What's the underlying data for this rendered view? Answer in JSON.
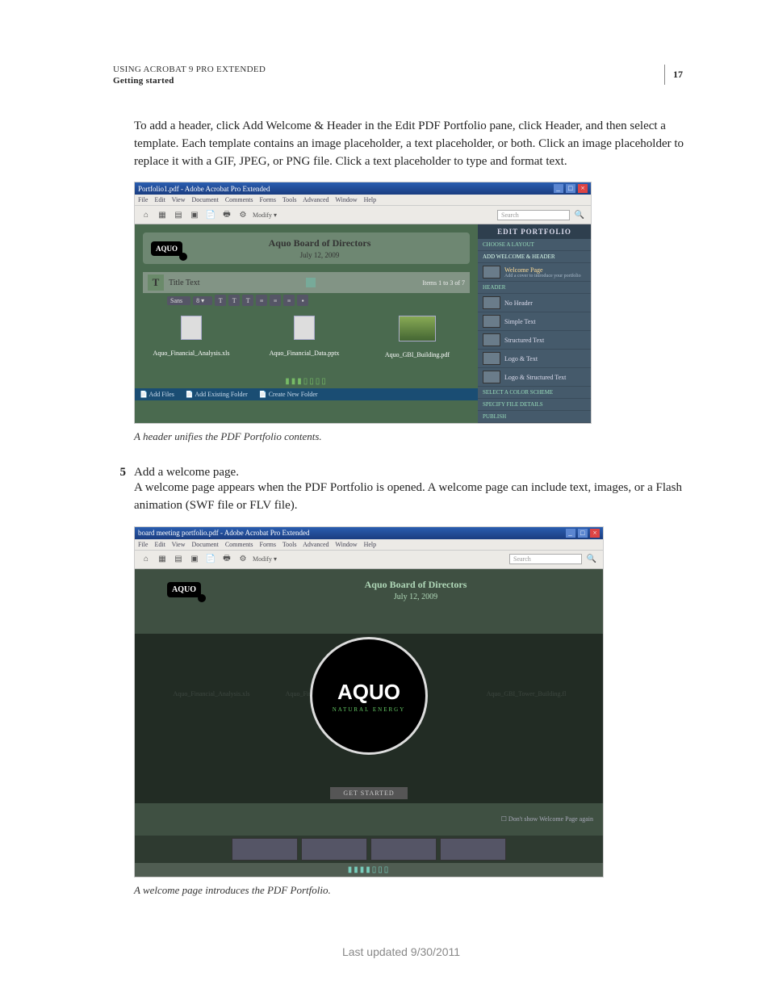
{
  "header": {
    "line1": "USING ACROBAT 9 PRO EXTENDED",
    "line2": "Getting started",
    "pagenum": "17"
  },
  "para1": "To add a header, click Add Welcome & Header in the Edit PDF Portfolio pane, click Header, and then select a template. Each template contains an image placeholder, a text placeholder, or both. Click an image placeholder to replace it with a GIF, JPEG, or PNG file. Click a text placeholder to type and format text.",
  "fig1": {
    "titlebar": "Portfolio1.pdf - Adobe Acrobat Pro Extended",
    "menus": [
      "File",
      "Edit",
      "View",
      "Document",
      "Comments",
      "Forms",
      "Tools",
      "Advanced",
      "Window",
      "Help"
    ],
    "modify": "Modify ▾",
    "search": "Search",
    "header_title": "Aquo Board of Directors",
    "header_date": "July 12, 2009",
    "logo": "AQUO",
    "title_text": "Title Text",
    "items_count": "Items 1 to 3 of 7",
    "font_sel": "Sans",
    "thumbs": [
      "Aquo_Financial_Analysis.xls",
      "Aquo_Financial_Data.pptx",
      "Aquo_GBI_Building.pdf"
    ],
    "bottombar": [
      "Add Files",
      "Add Existing Folder",
      "Create New Folder"
    ],
    "sidepane": {
      "title": "EDIT PORTFOLIO",
      "choose": "CHOOSE A LAYOUT",
      "addwh": "ADD WELCOME & HEADER",
      "welcome": "Welcome Page",
      "welcome_sub": "Add a cover to introduce your portfolio",
      "header": "Header",
      "opts": [
        "No Header",
        "Simple Text",
        "Structured Text",
        "Logo & Text",
        "Logo & Structured Text"
      ],
      "select_color": "SELECT A COLOR SCHEME",
      "specify": "SPECIFY FILE DETAILS",
      "publish": "PUBLISH"
    }
  },
  "caption1": "A header unifies the PDF Portfolio contents.",
  "step5_num": "5",
  "step5_text": "Add a welcome page.",
  "para2": "A welcome page appears when the PDF Portfolio is opened. A welcome page can include text, images, or a Flash animation (SWF file or FLV file).",
  "fig2": {
    "titlebar": "board meeting portfolio.pdf - Adobe Acrobat Pro Extended",
    "menus": [
      "File",
      "Edit",
      "View",
      "Document",
      "Comments",
      "Forms",
      "Tools",
      "Advanced",
      "Window",
      "Help"
    ],
    "search": "Search",
    "header_title": "Aquo Board of Directors",
    "header_date": "July 12, 2009",
    "logo": "AQUO",
    "biglogo": "AQUO",
    "biglogo_sub": "NATURAL ENERGY",
    "getstarted": "GET STARTED",
    "dontshow": "Don't show Welcome Page again",
    "ghosts": [
      "Aquo_Financial_Analysis.xls",
      "Aquo_Financial_Data...",
      "...pdf",
      "Aquo_GBI_Tower_Building.fl"
    ]
  },
  "caption2": "A welcome page introduces the PDF Portfolio.",
  "footer": "Last updated 9/30/2011"
}
